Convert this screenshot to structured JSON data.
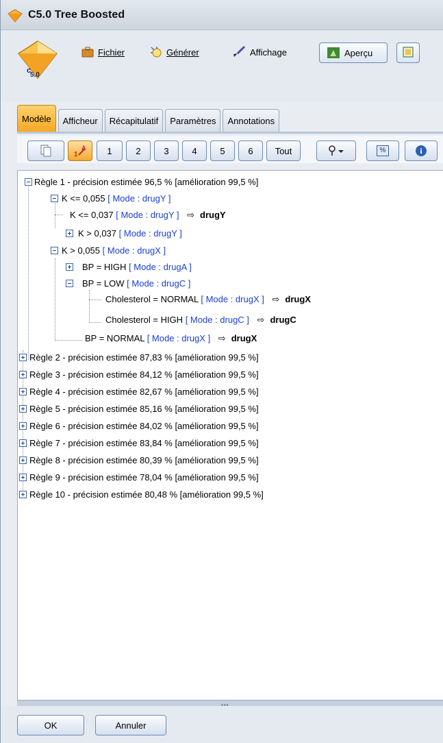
{
  "window": {
    "title": "C5.0 Tree Boosted"
  },
  "menu": {
    "file_label": "Fichier",
    "generate_label": "Générer",
    "view_label": "Affichage",
    "preview_label": "Aperçu",
    "model_icon_text": "5.0"
  },
  "tabs": [
    {
      "label": "Modèle",
      "active": true
    },
    {
      "label": "Afficheur",
      "active": false
    },
    {
      "label": "Récapitulatif",
      "active": false
    },
    {
      "label": "Paramètres",
      "active": false
    },
    {
      "label": "Annotations",
      "active": false
    }
  ],
  "toolbar": {
    "level_buttons": [
      "1",
      "2",
      "3",
      "4",
      "5",
      "6",
      "Tout"
    ],
    "percent_label": "%",
    "info_label": "i"
  },
  "tree": {
    "rule1": {
      "label": "Règle 1 - précision estimée 96,5 % [amélioration 99,5 %]",
      "k_low": {
        "cond": "K <= 0,055",
        "mode": "[ Mode : drugY ]"
      },
      "k_low_a": {
        "cond": "K <= 0,037",
        "mode": "[ Mode : drugY ]",
        "pred": "drugY"
      },
      "k_low_b": {
        "cond": "K > 0,037",
        "mode": "[ Mode : drugY ]"
      },
      "k_high": {
        "cond": "K > 0,055",
        "mode": "[ Mode : drugX ]"
      },
      "bp_high": {
        "cond": "BP = HIGH",
        "mode": "[ Mode : drugA ]"
      },
      "bp_low": {
        "cond": "BP = LOW",
        "mode": "[ Mode : drugC ]"
      },
      "chol_normal": {
        "cond": "Cholesterol = NORMAL",
        "mode": "[ Mode : drugX ]",
        "pred": "drugX"
      },
      "chol_high": {
        "cond": "Cholesterol = HIGH",
        "mode": "[ Mode : drugC ]",
        "pred": "drugC"
      },
      "bp_normal": {
        "cond": "BP = NORMAL",
        "mode": "[ Mode : drugX ]",
        "pred": "drugX"
      }
    },
    "rules": [
      "Règle 2 - précision estimée 87,83 % [amélioration 99,5 %]",
      "Règle 3 - précision estimée 84,12 % [amélioration 99,5 %]",
      "Règle 4 - précision estimée 82,67 % [amélioration 99,5 %]",
      "Règle 5 - précision estimée 85,16 % [amélioration 99,5 %]",
      "Règle 6 - précision estimée 84,02 % [amélioration 99,5 %]",
      "Règle 7 - précision estimée 83,84 % [amélioration 99,5 %]",
      "Règle 8 - précision estimée 80,39 % [amélioration 99,5 %]",
      "Règle 9 - précision estimée 78,04 % [amélioration 99,5 %]",
      "Règle 10 - précision estimée 80,48 % [amélioration 99,5 %]"
    ]
  },
  "footer": {
    "ok_label": "OK",
    "cancel_label": "Annuler"
  },
  "colors": {
    "mode_text": "#1a3fd6",
    "active_tab": "#f5a623"
  }
}
